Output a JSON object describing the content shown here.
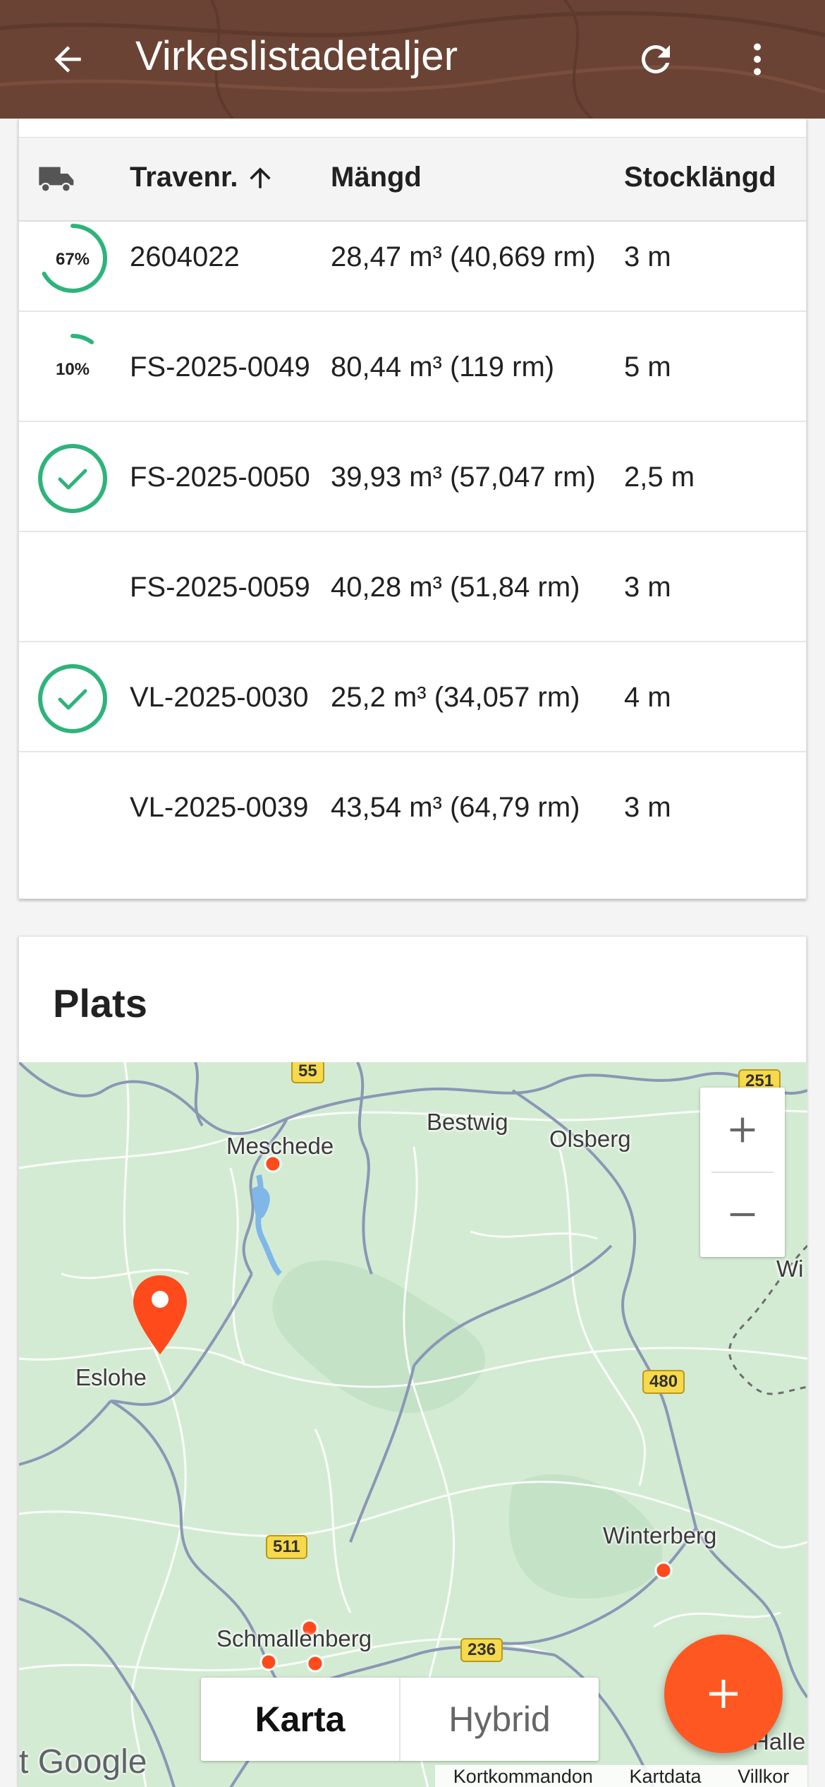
{
  "appbar": {
    "title": "Virkeslistadetaljer",
    "back_icon": "arrow-left-icon",
    "refresh_icon": "refresh-icon",
    "more_icon": "more-vert-icon",
    "color": "#6b4334"
  },
  "table": {
    "headers": {
      "truck_icon": "truck-icon",
      "trave": "Travenr.",
      "sort_icon": "arrow-up-icon",
      "mangd": "Mängd",
      "stock": "Stocklängd"
    },
    "rows": [
      {
        "status": "progress",
        "progress_label": "67%",
        "progress": 0.67,
        "trave": "2604022",
        "mangd": "28,47 m³ (40,669 rm)",
        "stock": "3 m"
      },
      {
        "status": "progress",
        "progress_label": "10%",
        "progress": 0.1,
        "trave": "FS-2025-0049",
        "mangd": "80,44 m³ (119 rm)",
        "stock": "5 m"
      },
      {
        "status": "done",
        "trave": "FS-2025-0050",
        "mangd": "39,93 m³ (57,047 rm)",
        "stock": "2,5 m"
      },
      {
        "status": "none",
        "trave": "FS-2025-0059",
        "mangd": "40,28 m³ (51,84 rm)",
        "stock": "3 m"
      },
      {
        "status": "done",
        "trave": "VL-2025-0030",
        "mangd": "25,2 m³ (34,057 rm)",
        "stock": "4 m"
      },
      {
        "status": "none",
        "trave": "VL-2025-0039",
        "mangd": "43,54 m³ (64,79 rm)",
        "stock": "3 m"
      }
    ],
    "accent_color": "#2eb37c"
  },
  "plats": {
    "title": "Plats",
    "map": {
      "places": {
        "meschede": "Meschede",
        "bestwig": "Bestwig",
        "olsberg": "Olsberg",
        "eslohe": "Eslohe",
        "winterberg": "Winterberg",
        "schmallenberg": "Schmallenberg",
        "wi": "Wi",
        "halle": "Halle"
      },
      "roads": {
        "r55": "55",
        "r251": "251",
        "r480": "480",
        "r511": "511",
        "r236": "236"
      },
      "zoom_in": "+",
      "zoom_out": "−",
      "map_types": {
        "karta": "Karta",
        "hybrid": "Hybrid"
      },
      "google": "Google",
      "google_prefix": "t",
      "footer": {
        "shortcuts": "Kortkommandon",
        "mapdata": "Kartdata",
        "terms": "Villkor"
      },
      "marker_color": "#ff4a1c"
    }
  },
  "fab": {
    "icon": "plus-icon",
    "color": "#ff5722"
  }
}
